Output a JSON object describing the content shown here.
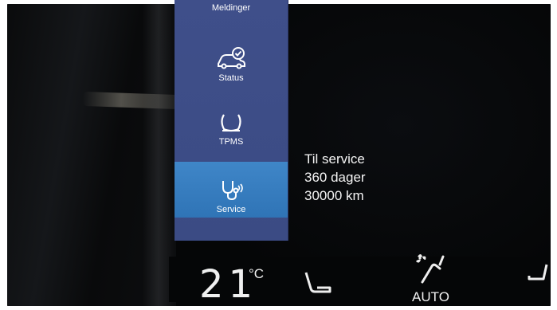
{
  "sidebar": {
    "items": [
      {
        "label": "Meldinger",
        "icon": "message-icon"
      },
      {
        "label": "Status",
        "icon": "car-check-icon"
      },
      {
        "label": "TPMS",
        "icon": "tire-pressure-icon"
      },
      {
        "label": "Service",
        "icon": "stethoscope-icon",
        "active": true
      }
    ]
  },
  "service_info": {
    "line1": "Til service",
    "line2": "360 dager",
    "line3": "30000 km"
  },
  "climate": {
    "temperature": "21",
    "unit": "°C",
    "auto_label": "AUTO"
  },
  "colors": {
    "sidebar": "#3c4c87",
    "active_item": "#3580c0",
    "text": "#ffffff",
    "screen_bg": "#050607"
  }
}
